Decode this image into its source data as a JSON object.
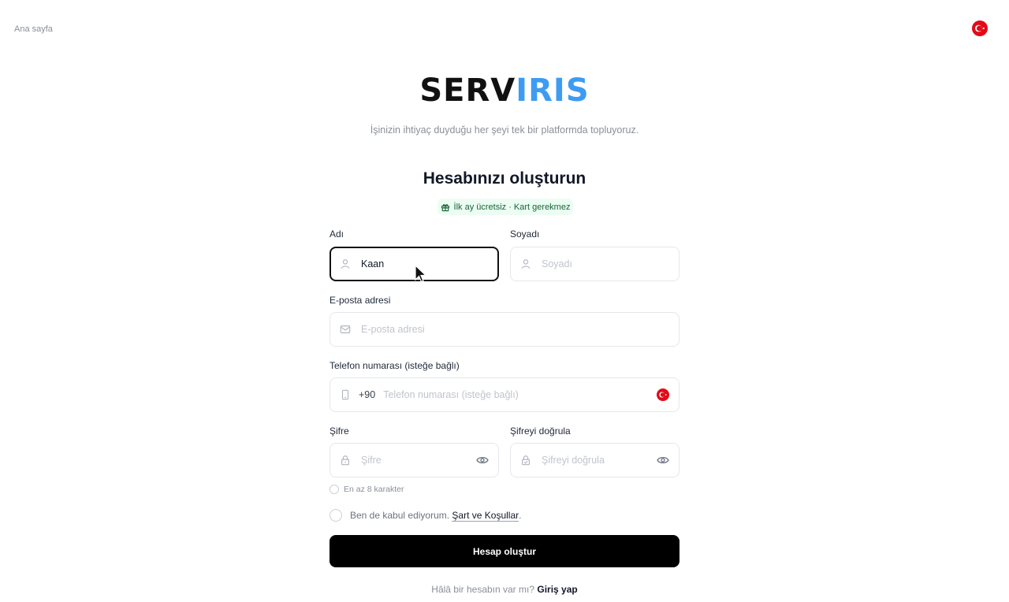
{
  "nav": {
    "home_label": "Ana sayfa",
    "language_flag": "turkey-flag-icon"
  },
  "brand": {
    "logo_part1": "SERV",
    "logo_part2": "IRIS",
    "accent_color": "#3d9cf2"
  },
  "tagline": "İşinizin ihtiyaç duyduğu her şeyi tek bir platformda topluyoruz.",
  "form": {
    "title": "Hesabınızı oluşturun",
    "promo": "İlk ay ücretsiz · Kart gerekmez",
    "first_name": {
      "label": "Adı",
      "value": "Kaan",
      "placeholder": "Adı"
    },
    "last_name": {
      "label": "Soyadı",
      "value": "",
      "placeholder": "Soyadı"
    },
    "email": {
      "label": "E-posta adresi",
      "value": "",
      "placeholder": "E-posta adresi"
    },
    "phone": {
      "label": "Telefon numarası (isteğe bağlı)",
      "prefix": "+90",
      "value": "",
      "placeholder": "Telefon numarası (isteğe bağlı)"
    },
    "password": {
      "label": "Şifre",
      "value": "",
      "placeholder": "Şifre"
    },
    "password_confirm": {
      "label": "Şifreyi doğrula",
      "value": "",
      "placeholder": "Şifreyi doğrula"
    },
    "password_hint": "En az 8 karakter",
    "terms_text": "Ben de kabul ediyorum.",
    "terms_link": "Şart ve Koşullar",
    "terms_suffix": ".",
    "submit_label": "Hesap oluştur",
    "login_prompt": "Hâlâ bir hesabın var mı?",
    "login_link": "Giriş yap"
  }
}
